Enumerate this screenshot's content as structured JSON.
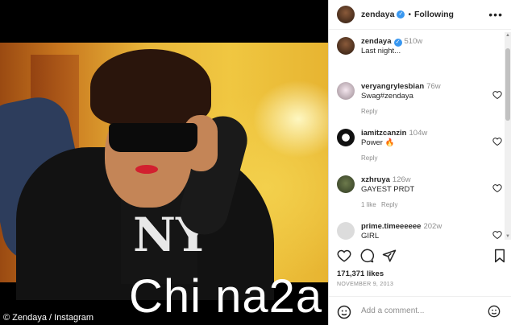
{
  "photo": {
    "watermark": "Chi na2a",
    "credit": "© Zendaya / Instagram",
    "shirt_logo": "NY"
  },
  "header": {
    "username": "zendaya",
    "separator": "•",
    "follow_label": "Following",
    "more_label": "•••"
  },
  "comments": [
    {
      "username": "zendaya",
      "time": "510w",
      "text": "Last night...",
      "meta": [
        "",
        ""
      ]
    },
    {
      "username": "veryangrylesbian",
      "time": "76w",
      "text": "Swag#zendaya",
      "meta": [
        "Reply",
        ""
      ]
    },
    {
      "username": "iamitzcanzin",
      "time": "104w",
      "text": "Power 🔥",
      "meta": [
        "Reply",
        ""
      ]
    },
    {
      "username": "xzhruya",
      "time": "126w",
      "text": "GAYEST PRDT",
      "meta": [
        "1 like",
        "Reply"
      ]
    },
    {
      "username": "prime.timeeeeee",
      "time": "202w",
      "text": "GIRL",
      "meta": [
        "",
        ""
      ]
    }
  ],
  "likes": "171,371 likes",
  "date": "NOVEMBER 9, 2013",
  "add_comment": {
    "placeholder": "Add a comment..."
  },
  "colors": {
    "link": "#3897f0",
    "text": "#262626",
    "muted": "#8e8e8e",
    "fire": "#f05a1a"
  }
}
